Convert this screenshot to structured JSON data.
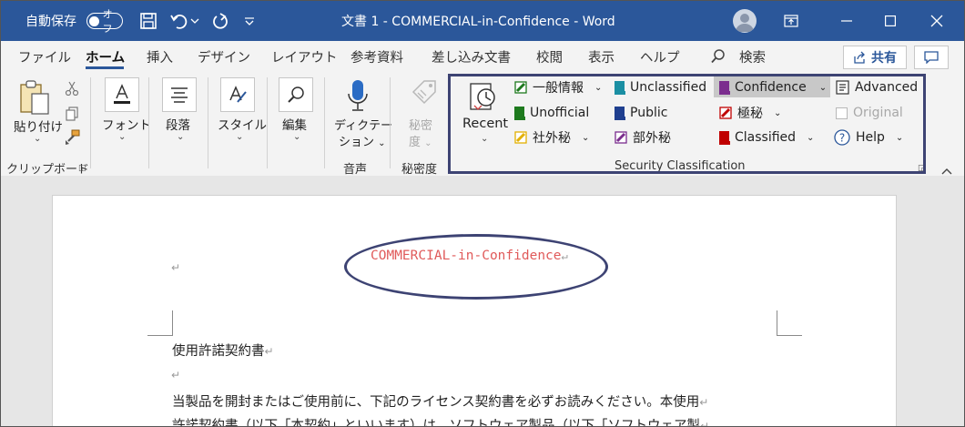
{
  "titlebar": {
    "autosave_label": "自動保存",
    "autosave_state": "オフ",
    "doc_title": "文書 1 - COMMERCIAL-in-Confidence - Word"
  },
  "tabs": [
    "ファイル",
    "ホーム",
    "挿入",
    "デザイン",
    "レイアウト",
    "参考資料",
    "差し込み文書",
    "校閲",
    "表示",
    "ヘルプ"
  ],
  "active_tab": "ホーム",
  "search_label": "検索",
  "share_label": "共有",
  "ribbon": {
    "clipboard": {
      "paste_label": "貼り付け",
      "group_label": "クリップボード"
    },
    "font": {
      "label": "フォント"
    },
    "paragraph": {
      "label": "段落"
    },
    "style": {
      "label": "スタイル"
    },
    "editing": {
      "label": "編集"
    },
    "voice": {
      "button_line1": "ディクテー",
      "button_line2": "ション",
      "group_label": "音声"
    },
    "sensitivity": {
      "button_line1": "秘密",
      "button_line2": "度",
      "group_label": "秘密度"
    },
    "security": {
      "recent_label": "Recent",
      "group_label": "Security Classification",
      "items": {
        "ippan": "一般情報",
        "unofficial": "Unofficial",
        "shagaihi": "社外秘",
        "unclassified": "Unclassified",
        "public": "Public",
        "bugaihi": "部外秘",
        "confidence": "Confidence",
        "gokuhi": "極秘",
        "classified": "Classified",
        "advanced": "Advanced",
        "original": "Original",
        "help": "Help"
      },
      "colors": {
        "green": "#1e7a1e",
        "yellow": "#e3b000",
        "teal": "#1b8fa3",
        "blue": "#1f3f8f",
        "purple": "#7b2d8e",
        "red": "#c00000",
        "header_red": "#e05a5a",
        "highlight_border": "#3d4373"
      }
    }
  },
  "document": {
    "header_text": "COMMERCIAL-in-Confidence",
    "line1": "使用許諾契約書",
    "line3": "当製品を開封またはご使用前に、下記のライセンス契約書を必ずお読みください。本使用",
    "line4": "許諾契約書（以下「本契約」といいます）は、ソフトウェア製品（以下「ソフトウェア製",
    "para_mark": "↵"
  }
}
